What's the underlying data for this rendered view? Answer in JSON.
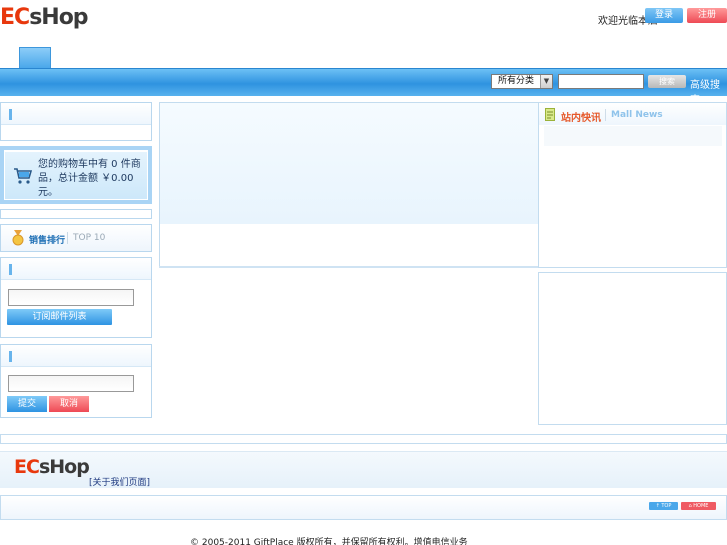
{
  "header": {
    "logo_text_red": "EC",
    "logo_text_dark": "sHop",
    "welcome": "欢迎光临本店",
    "login_label": "登录",
    "register_label": "注册"
  },
  "nav": {
    "category_selected": "所有分类",
    "search_button": "搜索",
    "advanced_search": "高级搜索",
    "search_value": ""
  },
  "cart": {
    "text": "您的购物车中有 0 件商品，总计金额 ￥0.00元。"
  },
  "ranking": {
    "title": "销售排行",
    "subtitle": "TOP 10"
  },
  "email": {
    "subscribe_button": "订阅邮件列表",
    "value": ""
  },
  "vote": {
    "submit_button": "提交",
    "cancel_button": "取消",
    "value": ""
  },
  "news": {
    "title": "站内快讯",
    "subtitle": "Mall News"
  },
  "footer": {
    "logo_red": "EC",
    "logo_dark": "sHop",
    "link": "[关于我们页面]",
    "top_label": "↑ TOP",
    "home_label": "⌂ HOME",
    "copyright": "© 2005-2011 GiftPlace 版权所有，并保留所有权利。增值电信业务"
  }
}
